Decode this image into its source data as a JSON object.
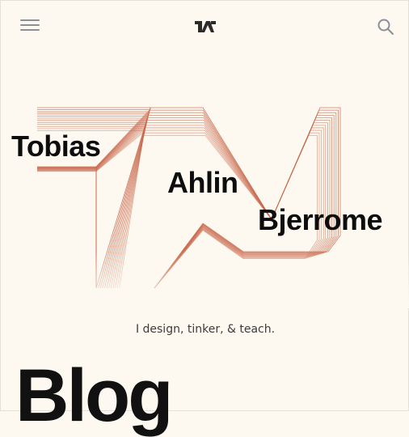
{
  "header": {
    "menu_icon": "hamburger-menu-icon",
    "logo_icon": "ta-logo-icon",
    "search_icon": "search-icon"
  },
  "hero": {
    "first_name": "Tobias",
    "middle_name": "Ahlin",
    "last_name": "Bjerrome",
    "monogram_color": "#c8674a"
  },
  "tagline": "I design, tinker, & teach.",
  "section": {
    "title": "Blog"
  },
  "colors": {
    "background": "#fdf9f1",
    "text": "#111111",
    "icon": "#8a8f98"
  }
}
